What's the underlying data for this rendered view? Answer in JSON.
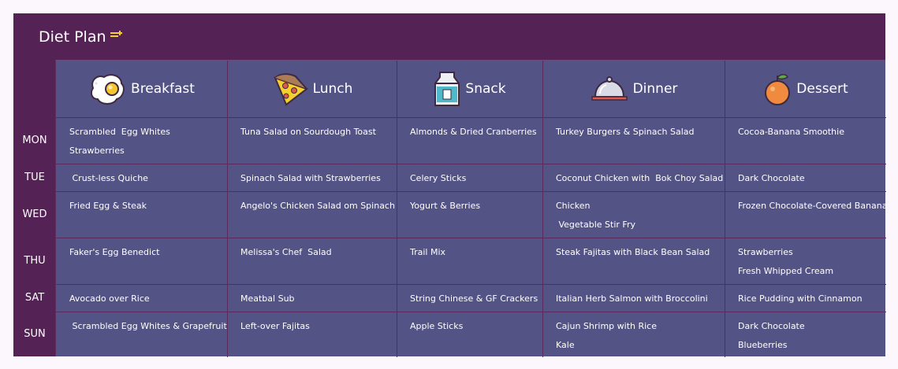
{
  "title": "Diet Plan",
  "headers": {
    "breakfast": "Breakfast",
    "lunch": "Lunch",
    "snack": "Snack",
    "dinner": "Dinner",
    "dessert": "Dessert"
  },
  "days": [
    "MON",
    "TUE",
    "WED",
    "THU",
    "SAT",
    "SUN"
  ],
  "cells": {
    "mon": {
      "breakfast": [
        "Scrambled  Egg Whites",
        "Strawberries"
      ],
      "lunch": [
        "Tuna Salad on Sourdough Toast"
      ],
      "snack": [
        "Almonds & Dried Cranberries"
      ],
      "dinner": [
        "Turkey Burgers & Spinach Salad"
      ],
      "dessert": [
        "Cocoa-Banana Smoothie"
      ]
    },
    "tue": {
      "breakfast": [
        " Crust-less Quiche"
      ],
      "lunch": [
        "Spinach Salad with Strawberries"
      ],
      "snack": [
        "Celery Sticks"
      ],
      "dinner": [
        "Coconut Chicken with  Bok Choy Salad"
      ],
      "dessert": [
        "Dark Chocolate"
      ]
    },
    "wed": {
      "breakfast": [
        "Fried Egg & Steak"
      ],
      "lunch": [
        "Angelo's Chicken Salad om Spinach"
      ],
      "snack": [
        "Yogurt & Berries"
      ],
      "dinner": [
        "Chicken",
        " Vegetable Stir Fry"
      ],
      "dessert": [
        "Frozen Chocolate-Covered Banana"
      ]
    },
    "thu": {
      "breakfast": [
        "Faker's Egg Benedict"
      ],
      "lunch": [
        "Melissa's Chef  Salad"
      ],
      "snack": [
        "Trail Mix"
      ],
      "dinner": [
        "Steak Fajitas with Black Bean Salad"
      ],
      "dessert": [
        "Strawberries",
        "Fresh Whipped Cream"
      ]
    },
    "sat": {
      "breakfast": [
        "Avocado over Rice"
      ],
      "lunch": [
        "Meatbal Sub"
      ],
      "snack": [
        "String Chinese & GF Crackers"
      ],
      "dinner": [
        "Italian Herb Salmon with Broccolini"
      ],
      "dessert": [
        "Rice Pudding with Cinnamon"
      ]
    },
    "sun": {
      "breakfast": [
        " Scrambled Egg Whites & Grapefruit"
      ],
      "lunch": [
        "Left-over Fajitas"
      ],
      "snack": [
        "Apple Sticks"
      ],
      "dinner": [
        "Cajun Shrimp with Rice",
        "Kale"
      ],
      "dessert": [
        "Dark Chocolate",
        "Blueberries"
      ]
    }
  },
  "colors": {
    "panel": "#542255",
    "grid": "#545385",
    "page": "#fcf7fd",
    "accent": "#f5cf2b"
  }
}
